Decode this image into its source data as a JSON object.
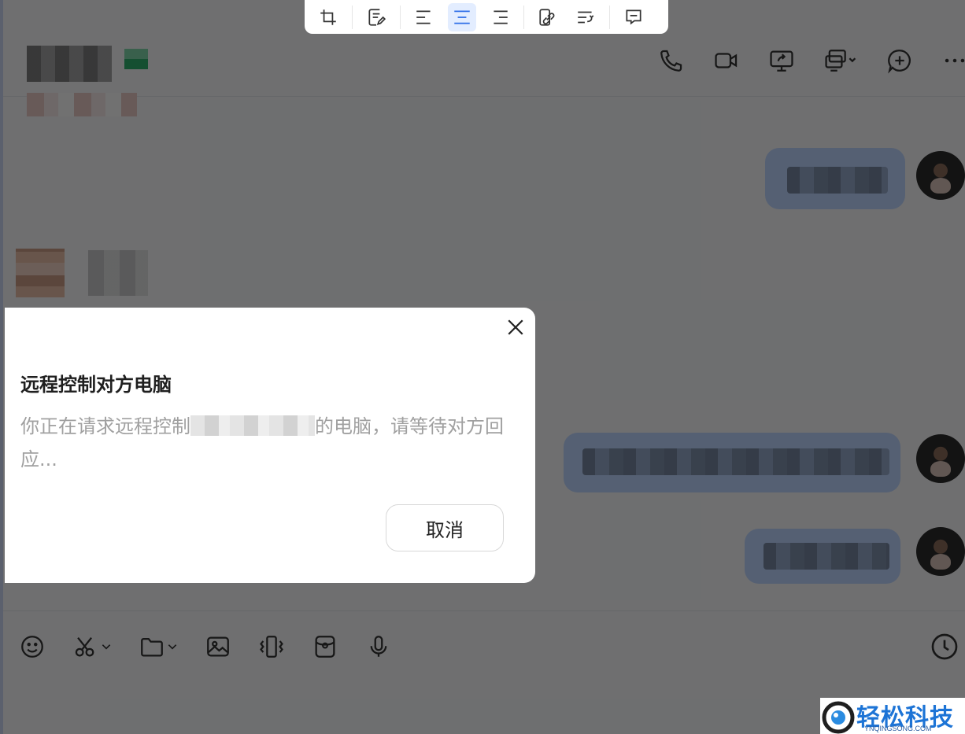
{
  "header": {
    "contact_initial": "",
    "actions": [
      {
        "name": "voice-call",
        "icon": "phone-icon"
      },
      {
        "name": "video-call",
        "icon": "video-camera-icon"
      },
      {
        "name": "screen-share",
        "icon": "share-screen-icon"
      },
      {
        "name": "remote-control",
        "icon": "remote-desktop-icon"
      },
      {
        "name": "add-member",
        "icon": "plus-circle-icon"
      },
      {
        "name": "more",
        "icon": "more-dots-icon"
      }
    ]
  },
  "floating_toolbar": {
    "tools": [
      "crop-icon",
      "edit-text-icon",
      "align-left-icon",
      "align-center-icon",
      "align-right-icon",
      "link-icon",
      "wrap-text-icon",
      "comment-icon"
    ],
    "active": "align-center-icon"
  },
  "composer": {
    "tools": [
      "emoji-icon",
      "scissors-icon",
      "folder-icon",
      "image-icon",
      "shake-icon",
      "red-packet-icon",
      "microphone-icon"
    ],
    "history_icon": "clock-icon"
  },
  "dialog": {
    "title": "远程控制对方电脑",
    "body_prefix": "你正在请求远程控制",
    "body_suffix": "的电脑，请等待对方回应...",
    "cancel_label": "取消"
  },
  "watermark": {
    "title": "轻松科技",
    "subtitle": "YNQINGSONG.COM"
  },
  "colors": {
    "overlay": "#000000",
    "accent": "#1d74d6",
    "active_tool_bg": "#e3edff"
  }
}
